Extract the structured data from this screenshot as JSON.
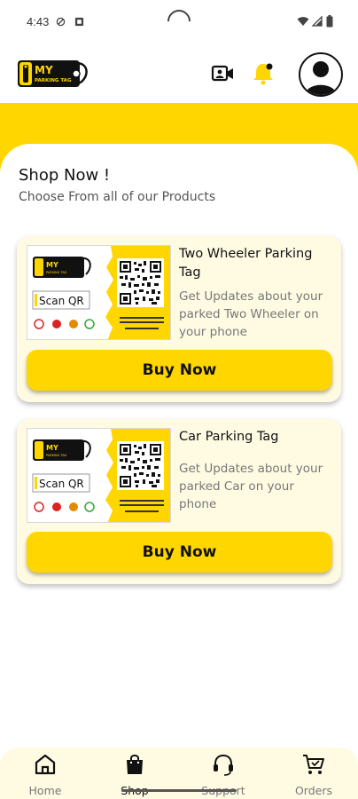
{
  "status_bar": {
    "time": "4:43"
  },
  "header": {
    "logo_text_line1": "MY",
    "logo_text_line2": "PARKING TAG",
    "video_icon": "video-call-icon",
    "bell_icon": "bell-icon",
    "avatar_icon": "avatar-icon"
  },
  "colors": {
    "brand_yellow": "#FFD600",
    "card_bg": "#FFFBE3"
  },
  "shop": {
    "title": "Shop Now !",
    "subtitle": "Choose From all of our Products"
  },
  "tag_art": {
    "scan_label": "Scan QR"
  },
  "products": [
    {
      "name": "Two Wheeler Parking Tag",
      "description": "Get Updates about your parked Two Wheeler on your phone",
      "button": "Buy Now"
    },
    {
      "name": "Car Parking Tag",
      "description": "Get Updates about your parked Car on your phone",
      "button": "Buy Now"
    }
  ],
  "bottom_nav": [
    {
      "label": "Home",
      "icon": "home-icon"
    },
    {
      "label": "Shop",
      "icon": "shopping-bag-icon"
    },
    {
      "label": "Support",
      "icon": "headset-icon"
    },
    {
      "label": "Orders",
      "icon": "cart-icon"
    }
  ]
}
